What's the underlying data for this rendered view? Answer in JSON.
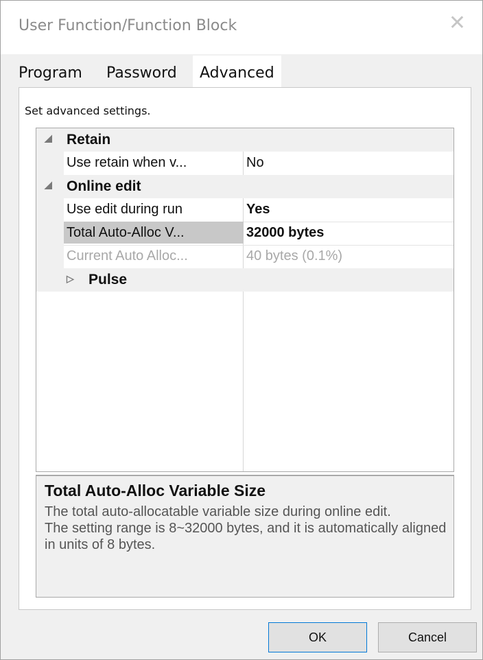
{
  "window": {
    "title": "User Function/Function Block"
  },
  "tabs": [
    {
      "label": "Program"
    },
    {
      "label": "Password"
    },
    {
      "label": "Advanced"
    }
  ],
  "panel": {
    "caption": "Set advanced settings."
  },
  "grid": {
    "categories": [
      {
        "label": "Retain"
      },
      {
        "label": "Online edit"
      },
      {
        "label": "Pulse"
      }
    ],
    "properties": [
      {
        "name": "Use retain when v...",
        "value": "No"
      },
      {
        "name": "Use edit during run",
        "value": "Yes"
      },
      {
        "name": "Total Auto-Alloc V...",
        "value": "32000 bytes"
      },
      {
        "name": "Current Auto Alloc...",
        "value": "40 bytes (0.1%)"
      }
    ]
  },
  "description": {
    "title": "Total Auto-Alloc Variable Size",
    "body": "The total auto-allocatable variable size during online edit.\nThe setting range is 8~32000 bytes, and it is automatically aligned in units of 8 bytes."
  },
  "buttons": {
    "ok": "OK",
    "cancel": "Cancel"
  }
}
